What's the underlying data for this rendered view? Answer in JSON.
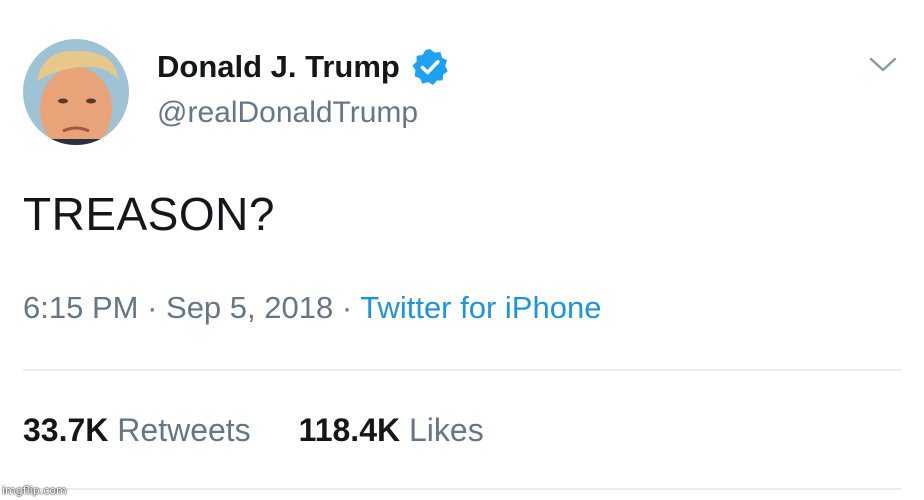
{
  "tweet": {
    "author": {
      "display_name": "Donald J. Trump",
      "handle": "@realDonaldTrump",
      "verified": true,
      "verified_icon": "verified-badge-icon"
    },
    "text": "TREASON?",
    "meta": {
      "time": "6:15 PM",
      "separator": " · ",
      "date": "Sep 5, 2018",
      "source": "Twitter for iPhone"
    },
    "stats": {
      "retweets_count": "33.7K",
      "retweets_label": "Retweets",
      "likes_count": "118.4K",
      "likes_label": "Likes"
    },
    "menu_icon": "chevron-down-icon"
  },
  "watermark": "imgflip.com",
  "colors": {
    "primary_text": "#14171a",
    "secondary_text": "#657786",
    "link": "#1b95e0",
    "verified_badge": "#1da1f2",
    "divider": "#e6ecf0"
  }
}
